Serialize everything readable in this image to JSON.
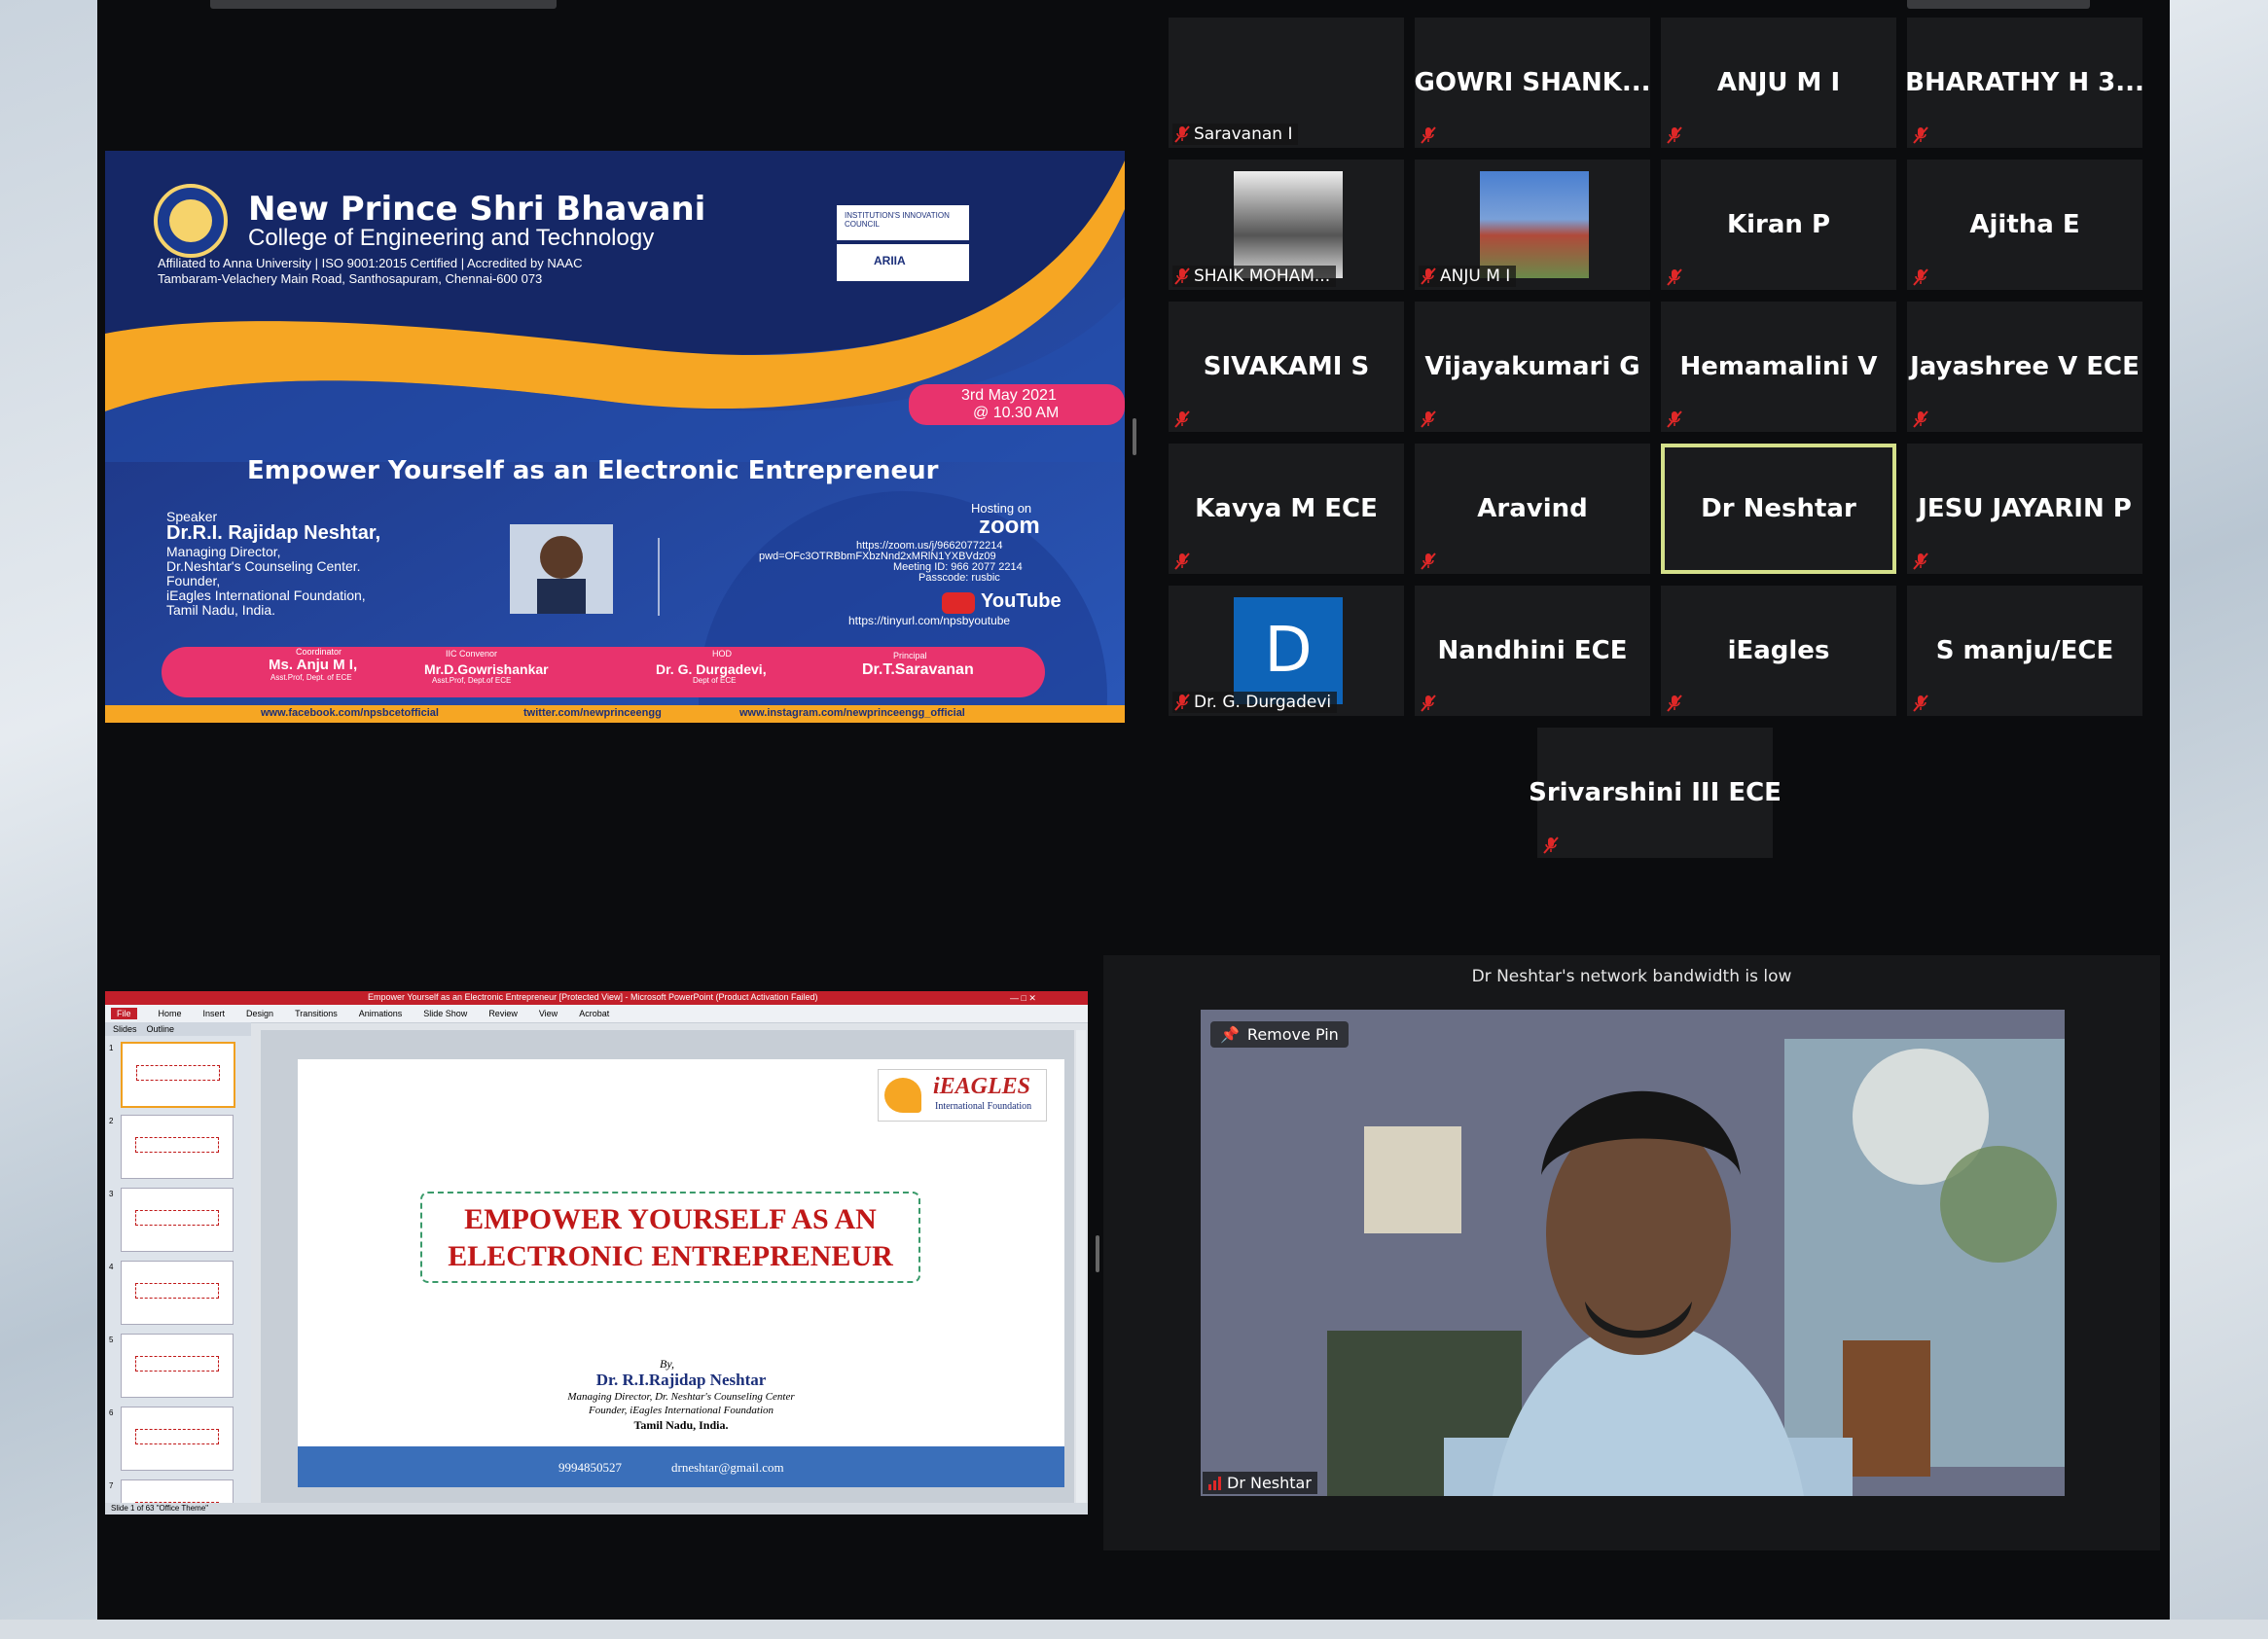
{
  "gallery": {
    "tiles": [
      {
        "name": "",
        "label": "Saravanan I",
        "muted": true
      },
      {
        "name": "GOWRI  SHANK...",
        "muted": true
      },
      {
        "name": "ANJU M I",
        "muted": true
      },
      {
        "name": "BHARATHY H 3...",
        "muted": true
      },
      {
        "name": "",
        "label": "SHAIK MOHAM...",
        "muted": true,
        "has_photo": true
      },
      {
        "name": "",
        "label": "ANJU M I",
        "muted": true,
        "has_photo": true
      },
      {
        "name": "Kiran P",
        "muted": true
      },
      {
        "name": "Ajitha E",
        "muted": true
      },
      {
        "name": "SIVAKAMI S",
        "muted": true
      },
      {
        "name": "Vijayakumari G",
        "muted": true
      },
      {
        "name": "Hemamalini V",
        "muted": true
      },
      {
        "name": "Jayashree V ECE",
        "muted": true
      },
      {
        "name": "Kavya M ECE",
        "muted": true
      },
      {
        "name": "Aravind",
        "muted": true
      },
      {
        "name": "Dr Neshtar",
        "muted": false,
        "active_speaker": true
      },
      {
        "name": "JESU JAYARIN P",
        "muted": true
      },
      {
        "name": "",
        "label": "Dr. G. Durgadevi",
        "muted": true,
        "avatar_letter": "D"
      },
      {
        "name": "Nandhini ECE",
        "muted": true
      },
      {
        "name": "iEagles",
        "muted": true
      },
      {
        "name": "S manju/ECE",
        "muted": true
      },
      {
        "name": "Srivarshini III ECE",
        "muted": true
      }
    ]
  },
  "poster": {
    "college_line1": "New Prince Shri Bhavani",
    "college_line2": "College of Engineering and Technology",
    "affiliation1": "Affiliated to Anna University | ISO 9001:2015 Certified | Accredited by NAAC",
    "affiliation2": "Tambaram-Velachery Main Road, Santhosapuram, Chennai-600 073",
    "badge1": "INSTITUTION'S INNOVATION COUNCIL",
    "badge2": "ARIIA",
    "date": "3rd May 2021",
    "time": "@ 10.30 AM",
    "title": "Empower Yourself as an Electronic Entrepreneur",
    "speaker_caption": "Speaker",
    "speaker_name": "Dr.R.I. Rajidap Neshtar,",
    "speaker_role1": "Managing Director,",
    "speaker_role2": "Dr.Neshtar's Counseling Center.",
    "speaker_role3": "Founder,",
    "speaker_role4": "iEagles International Foundation,",
    "speaker_role5": "Tamil Nadu, India.",
    "hosting_on": "Hosting on",
    "zoom": "zoom",
    "zoom_link": "https://zoom.us/j/96620772214",
    "zoom_pwd": "pwd=OFc3OTRBbmFXbzNnd2xMRlN1YXBVdz09",
    "meeting_id": "Meeting ID: 966 2077 2214",
    "passcode": "Passcode: rusbic",
    "youtube": "YouTube",
    "youtube_link": "https://tinyurl.com/npsbyoutube",
    "people": [
      {
        "role": "Coordinator",
        "name": "Ms. Anju M I,",
        "sub": "Asst.Prof, Dept. of ECE"
      },
      {
        "role": "IIC Convenor",
        "name": "Mr.D.Gowrishankar",
        "sub": "Asst.Prof, Dept.of ECE"
      },
      {
        "role": "HOD",
        "name": "Dr. G. Durgadevi,",
        "sub": "Dept of ECE"
      },
      {
        "role": "Principal",
        "name": "Dr.T.Saravanan",
        "sub": ""
      }
    ],
    "footer_fb": "www.facebook.com/npsbcetofficial",
    "footer_tw": "twitter.com/newprinceengg",
    "footer_ig": "www.instagram.com/newprinceengg_official"
  },
  "ppt": {
    "title_bar": "Empower Yourself as an Electronic Entrepreneur  [Protected View] - Microsoft PowerPoint (Product Activation Failed)",
    "ribbon_tabs": [
      "File",
      "Home",
      "Insert",
      "Design",
      "Transitions",
      "Animations",
      "Slide Show",
      "Review",
      "View",
      "Acrobat"
    ],
    "panel_tabs": [
      "Slides",
      "Outline"
    ],
    "slide_title_line1": "EMPOWER YOURSELF AS AN",
    "slide_title_line2": "ELECTRONIC ENTREPRENEUR",
    "logo_text": "iEAGLES",
    "logo_sub": "International Foundation",
    "by": "By,",
    "author": "Dr. R.I.Rajidap Neshtar",
    "author_role1": "Managing Director, Dr. Neshtar's Counseling Center",
    "author_role2": "Founder, iEagles International Foundation",
    "author_role3": "Tamil Nadu, India.",
    "phone": "9994850527",
    "email": "drneshtar@gmail.com",
    "status": "Slide 1 of 63   \"Office Theme\"",
    "slide_numbers": [
      "1",
      "2",
      "3",
      "4",
      "5",
      "6",
      "7"
    ]
  },
  "video": {
    "bandwidth_notice": "Dr Neshtar's network bandwidth is low",
    "remove_pin": "Remove Pin",
    "name": "Dr Neshtar"
  },
  "colors": {
    "window_bg": "#0b0c0e",
    "tile_bg": "#1a1b1d",
    "active_border": "#d4e08a",
    "muted_red": "#e02828"
  }
}
